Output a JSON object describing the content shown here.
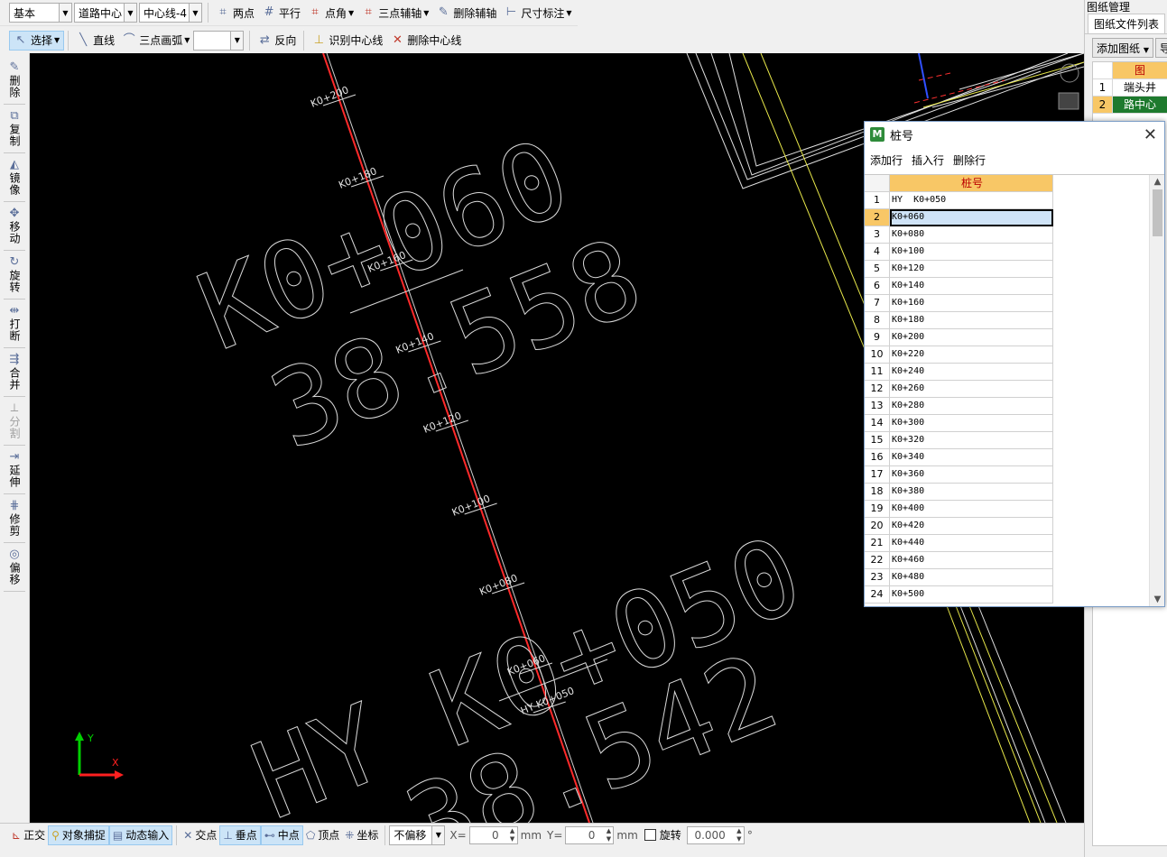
{
  "toolbar1": {
    "mode_combo": "基本",
    "layer_combo": "道路中心",
    "line_combo": "中心线-4",
    "two_point": "两点",
    "parallel": "平行",
    "point_angle": "点角",
    "three_point_axis": "三点辅轴",
    "delete_axis": "删除辅轴",
    "dimension": "尺寸标注"
  },
  "toolbar2": {
    "select": "选择",
    "line": "直线",
    "three_point_arc": "三点画弧",
    "reverse": "反向",
    "identify_centerline": "识别中心线",
    "delete_centerline": "删除中心线"
  },
  "vtools": [
    {
      "label": "删除",
      "icon": "eraser-icon",
      "disabled": false
    },
    {
      "label": "复制",
      "icon": "copy-icon",
      "disabled": false
    },
    {
      "label": "镜像",
      "icon": "mirror-icon",
      "disabled": false
    },
    {
      "label": "移动",
      "icon": "move-icon",
      "disabled": false
    },
    {
      "label": "旋转",
      "icon": "rotate-icon",
      "disabled": false
    },
    {
      "label": "打断",
      "icon": "break-icon",
      "disabled": false
    },
    {
      "label": "合并",
      "icon": "merge-icon",
      "disabled": false
    },
    {
      "label": "分割",
      "icon": "split-icon",
      "disabled": true
    },
    {
      "label": "延伸",
      "icon": "extend-icon",
      "disabled": false
    },
    {
      "label": "修剪",
      "icon": "trim-icon",
      "disabled": false
    },
    {
      "label": "偏移",
      "icon": "offset-icon",
      "disabled": false
    }
  ],
  "canvas": {
    "station_labels": [
      "K0+200",
      "K0+180",
      "K0+160",
      "K0+140",
      "K0+120",
      "K0+100",
      "K0+080",
      "K0+060",
      "HY K0+050"
    ],
    "big_text_upper_station": "K0+060",
    "big_text_upper_elev": "38.558",
    "big_text_lower_station": "HY K0+050",
    "big_text_lower_elev": "38.542",
    "axis_y": "Y",
    "axis_x": "X",
    "colors": {
      "centerline": "#ff2a2a",
      "yellow_lines": "#e8e84a",
      "text": "#e6e6e6"
    }
  },
  "right_panel": {
    "title": "图纸管理",
    "tab": "图纸文件列表",
    "add_button": "添加图纸",
    "import_button": "导入",
    "header": "图",
    "rows": [
      {
        "num": "1",
        "name": "端头井"
      },
      {
        "num": "2",
        "name": "路中心"
      }
    ]
  },
  "dialog": {
    "title": "桩号",
    "logo": "M",
    "menu": [
      "添加行",
      "插入行",
      "删除行"
    ],
    "column_header": "桩号",
    "selected_row": 2,
    "rows": [
      "HY  K0+050",
      "K0+060",
      "K0+080",
      "K0+100",
      "K0+120",
      "K0+140",
      "K0+160",
      "K0+180",
      "K0+200",
      "K0+220",
      "K0+240",
      "K0+260",
      "K0+280",
      "K0+300",
      "K0+320",
      "K0+340",
      "K0+360",
      "K0+380",
      "K0+400",
      "K0+420",
      "K0+440",
      "K0+460",
      "K0+480",
      "K0+500"
    ]
  },
  "status": {
    "ortho": "正交",
    "snap": "对象捕捉",
    "dynamic_input": "动态输入",
    "intersection": "交点",
    "perpendicular": "垂点",
    "midpoint": "中点",
    "vertex": "顶点",
    "coordinate": "坐标",
    "offset_combo": "不偏移",
    "x_label": "X=",
    "x_value": "0",
    "y_label": "Y=",
    "y_value": "0",
    "unit": "mm",
    "rotate_label": "旋转",
    "rotate_value": "0.000",
    "degree": "°"
  }
}
